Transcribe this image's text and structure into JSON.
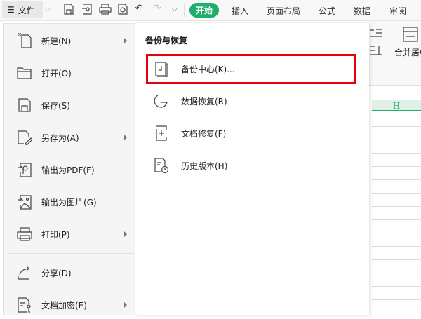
{
  "topbar": {
    "file_label": "文件",
    "tabs": [
      "开始",
      "插入",
      "页面布局",
      "公式",
      "数据",
      "审阅"
    ]
  },
  "file_menu": {
    "items": [
      {
        "label": "新建(N)",
        "icon": "new-file-icon",
        "submenu": true
      },
      {
        "label": "打开(O)",
        "icon": "folder-open-icon",
        "submenu": false
      },
      {
        "label": "保存(S)",
        "icon": "save-icon",
        "submenu": false
      },
      {
        "label": "另存为(A)",
        "icon": "save-as-icon",
        "submenu": true
      },
      {
        "label": "输出为PDF(F)",
        "icon": "export-pdf-icon",
        "submenu": false
      },
      {
        "label": "输出为图片(G)",
        "icon": "export-image-icon",
        "submenu": false
      },
      {
        "label": "打印(P)",
        "icon": "print-icon",
        "submenu": true
      },
      {
        "label": "分享(D)",
        "icon": "share-icon",
        "submenu": false
      },
      {
        "label": "文档加密(E)",
        "icon": "encrypt-icon",
        "submenu": true
      }
    ]
  },
  "submenu": {
    "title": "备份与恢复",
    "items": [
      {
        "label": "备份中心(K)...",
        "icon": "backup-center-icon",
        "highlighted": true
      },
      {
        "label": "数据恢复(R)",
        "icon": "data-recovery-icon"
      },
      {
        "label": "文档修复(F)",
        "icon": "doc-repair-icon"
      },
      {
        "label": "历史版本(H)",
        "icon": "history-version-icon"
      }
    ]
  },
  "ribbon": {
    "merge_label": "合并居中"
  },
  "sheet": {
    "column": "H"
  },
  "colors": {
    "accent": "#1fae6b",
    "highlight": "#e8000b"
  }
}
